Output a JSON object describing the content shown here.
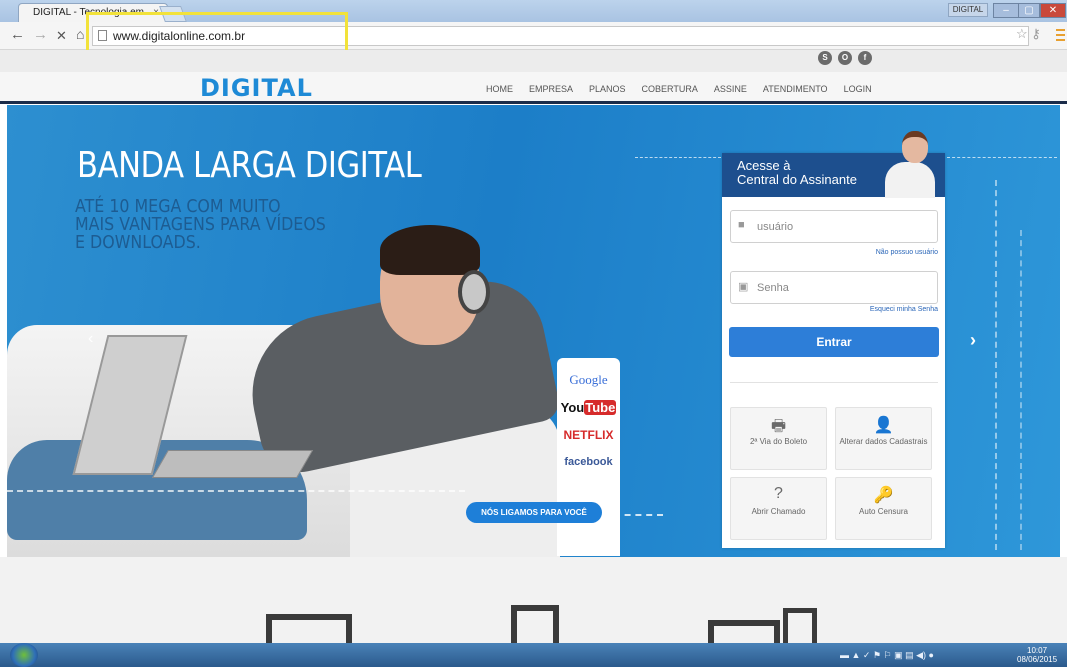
{
  "browser": {
    "tab_title": "DIGITAL - Tecnologia em",
    "tab_close": "×",
    "window_title": "DIGITAL",
    "url": "www.digitalonline.com.br",
    "nav_back": "←",
    "nav_forward": "→",
    "nav_stop": "✕",
    "nav_home": "⌂",
    "window_min": "–",
    "window_max": "▢",
    "window_close": "✕",
    "star": "☆ ⚷"
  },
  "site": {
    "logo": "DIGITAL",
    "nav": [
      "HOME",
      "EMPRESA",
      "PLANOS",
      "COBERTURA",
      "ASSINE",
      "ATENDIMENTO",
      "LOGIN"
    ],
    "social": [
      "S",
      "O",
      "f"
    ]
  },
  "hero": {
    "title": "BANDA LARGA DIGITAL",
    "subtitle_line1": "ATÉ 10 MEGA COM MUITO",
    "subtitle_line2": "MAIS VANTAGENS PARA VÍDEOS",
    "subtitle_line3": "E DOWNLOADS.",
    "brands": {
      "google": "Google",
      "youtube_you": "You",
      "youtube_tube": "Tube",
      "netflix": "NETFLIX",
      "facebook": "facebook"
    },
    "cta": "NÓS LIGAMOS PARA VOCÊ",
    "prev_arrow": "‹",
    "next_arrow": "›"
  },
  "login": {
    "title_line1": "Acesse à",
    "title_line2": "Central do Assinante",
    "user_placeholder": "usuário",
    "no_user_link": "Não possuo usuário",
    "pass_placeholder": "Senha",
    "forgot_link": "Esqueci minha Senha",
    "submit": "Entrar",
    "tiles": [
      {
        "icon": "🖶",
        "label": "2ª Via do Boleto"
      },
      {
        "icon": "👤",
        "label": "Alterar dados Cadastrais"
      },
      {
        "icon": "?",
        "label": "Abrir Chamado"
      },
      {
        "icon": "🔑",
        "label": "Auto Censura"
      }
    ]
  },
  "taskbar": {
    "tray": "▬ ▲ ✓ ⚑ ⚐ ▣ ▤ ◀) ●",
    "time": "10:07",
    "date": "08/06/2015"
  },
  "colors": {
    "brand_blue": "#1e8ad6",
    "hero_blue": "#1c7ec8",
    "panel_header": "#1d4f8e",
    "button_blue": "#2d7ed8"
  }
}
